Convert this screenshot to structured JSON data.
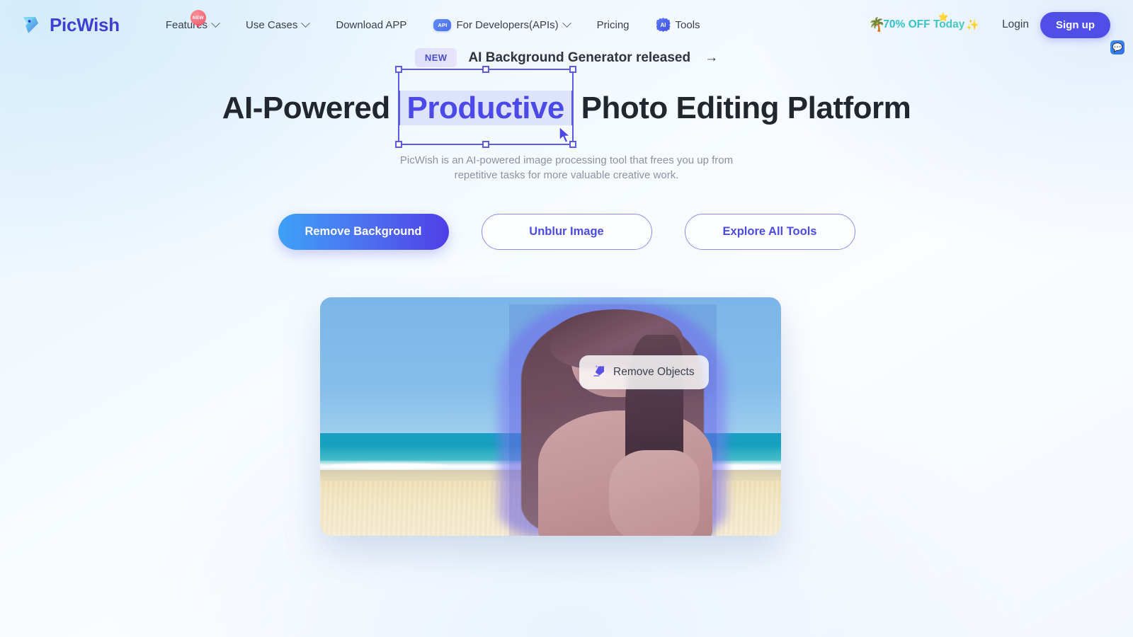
{
  "brand": {
    "name": "PicWish",
    "logo_icon": "picwish-bird-logo",
    "accent": "#4f4fe8"
  },
  "nav": {
    "items": [
      {
        "label": "Features",
        "icon": "chevron-down-icon",
        "has_chevron": true,
        "badge": "NEW"
      },
      {
        "label": "Use Cases",
        "icon": "chevron-down-icon",
        "has_chevron": true
      },
      {
        "label": "Download APP",
        "has_chevron": false
      },
      {
        "label": "For Developers(APIs)",
        "prefix_icon": "api-badge-icon",
        "prefix_label": "API",
        "has_chevron": true
      },
      {
        "label": "Pricing",
        "has_chevron": false
      },
      {
        "label": "Tools",
        "prefix_icon": "ai-badge-icon",
        "prefix_label": "AI",
        "has_chevron": false
      }
    ]
  },
  "header_right": {
    "promo": {
      "text": "70% OFF Today",
      "palm_icon": "palm-tree-icon",
      "sparkle_icon": "sparkle-icon",
      "color": "#2bbfd0"
    },
    "login_label": "Login",
    "signup_label": "Sign up",
    "chat_icon": "chat-support-icon"
  },
  "announcement": {
    "badge": "NEW",
    "text": "AI Background Generator released",
    "arrow": "→"
  },
  "hero": {
    "headline_before": "AI-Powered",
    "headline_selected": "Productive",
    "headline_after": "Photo Editing Platform",
    "subtitle_line1": "PicWish is an AI-powered image processing tool that frees you up from",
    "subtitle_line2": "repetitive tasks for more valuable creative work.",
    "cursor_icon": "mouse-cursor-icon",
    "selection_color": "#5b5be8"
  },
  "cta": {
    "primary": "Remove Background",
    "secondary": "Unblur Image",
    "tertiary": "Explore All Tools"
  },
  "hero_image": {
    "scene": "woman-on-beach-photo",
    "chip": {
      "label": "Remove Objects",
      "icon": "eraser-icon"
    }
  }
}
